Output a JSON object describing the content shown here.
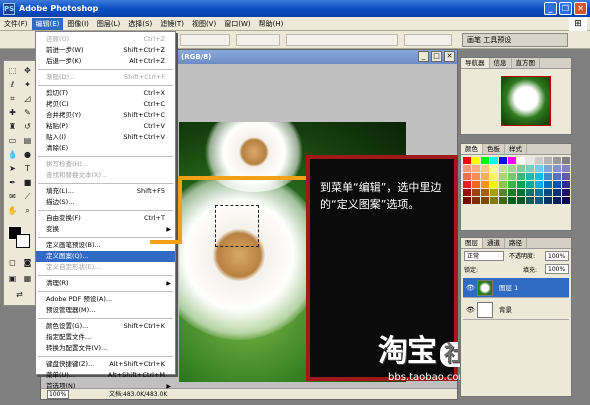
{
  "window": {
    "title": "Adobe Photoshop",
    "ps_badge": "PS"
  },
  "menubar": {
    "items": [
      "文件(F)",
      "编辑(E)",
      "图像(I)",
      "图层(L)",
      "选择(S)",
      "滤镜(T)",
      "视图(V)",
      "窗口(W)",
      "帮助(H)"
    ],
    "active_index": 1
  },
  "options": {
    "palette_tab": "画笔 工具预设"
  },
  "document": {
    "title": "(RGB/8)",
    "zoom": "100%",
    "doc_info": "文档:483.0K/483.0K"
  },
  "edit_menu": {
    "items": [
      {
        "label": "还原(O)",
        "shortcut": "Ctrl+Z",
        "disabled": true
      },
      {
        "label": "前进一步(W)",
        "shortcut": "Shift+Ctrl+Z"
      },
      {
        "label": "后退一步(K)",
        "shortcut": "Alt+Ctrl+Z"
      },
      {
        "sep": true
      },
      {
        "label": "渐隐(D)...",
        "shortcut": "Shift+Ctrl+F",
        "disabled": true
      },
      {
        "sep": true
      },
      {
        "label": "剪切(T)",
        "shortcut": "Ctrl+X"
      },
      {
        "label": "拷贝(C)",
        "shortcut": "Ctrl+C"
      },
      {
        "label": "合并拷贝(Y)",
        "shortcut": "Shift+Ctrl+C"
      },
      {
        "label": "粘贴(P)",
        "shortcut": "Ctrl+V"
      },
      {
        "label": "贴入(I)",
        "shortcut": "Shift+Ctrl+V"
      },
      {
        "label": "清除(E)",
        "shortcut": ""
      },
      {
        "sep": true
      },
      {
        "label": "拼写检查(H)...",
        "shortcut": "",
        "disabled": true
      },
      {
        "label": "查找和替换文本(X)...",
        "shortcut": "",
        "disabled": true
      },
      {
        "sep": true
      },
      {
        "label": "填充(L)...",
        "shortcut": "Shift+F5"
      },
      {
        "label": "描边(S)...",
        "shortcut": ""
      },
      {
        "sep": true
      },
      {
        "label": "自由变换(F)",
        "shortcut": "Ctrl+T"
      },
      {
        "label": "变换",
        "shortcut": "",
        "submenu": true
      },
      {
        "sep": true
      },
      {
        "label": "定义画笔预设(B)...",
        "shortcut": ""
      },
      {
        "label": "定义图案(Q)...",
        "shortcut": "",
        "selected": true
      },
      {
        "label": "定义自定形状(E)...",
        "shortcut": "",
        "disabled": true
      },
      {
        "sep": true
      },
      {
        "label": "清理(R)",
        "shortcut": "",
        "submenu": true
      },
      {
        "sep": true
      },
      {
        "label": "Adobe PDF 预设(A)...",
        "shortcut": ""
      },
      {
        "label": "预设管理器(M)...",
        "shortcut": ""
      },
      {
        "sep": true
      },
      {
        "label": "颜色设置(G)...",
        "shortcut": "Shift+Ctrl+K"
      },
      {
        "label": "指定配置文件...",
        "shortcut": ""
      },
      {
        "label": "转换为配置文件(V)...",
        "shortcut": ""
      },
      {
        "sep": true
      },
      {
        "label": "键盘快捷键(Z)...",
        "shortcut": "Alt+Shift+Ctrl+K"
      },
      {
        "label": "菜单(U)...",
        "shortcut": "Alt+Shift+Ctrl+M"
      },
      {
        "label": "首选项(N)",
        "shortcut": "",
        "submenu": true
      }
    ]
  },
  "callout": {
    "text": "到菜单“编辑”，选中里边的“定义图案”选项。"
  },
  "watermark": {
    "brand": "淘宝",
    "badge": "社区",
    "url": "bbs.taobao.com"
  },
  "navigator": {
    "tabs": [
      "导航器",
      "信息",
      "直方图"
    ]
  },
  "color_panel": {
    "tabs": [
      "颜色",
      "色板",
      "样式"
    ]
  },
  "layers_panel": {
    "tabs": [
      "图层",
      "通道",
      "路径"
    ],
    "blend_mode": "正常",
    "opacity_label": "不透明度:",
    "opacity_value": "100%",
    "lock_label": "锁定:",
    "fill_label": "填充:",
    "fill_value": "100%",
    "layers": [
      {
        "name": "图层 1",
        "selected": true
      },
      {
        "name": "背景",
        "selected": false
      }
    ]
  },
  "swatch_colors": [
    "#ff0000",
    "#ffff00",
    "#00ff00",
    "#00ffff",
    "#0000ff",
    "#ff00ff",
    "#ffffff",
    "#e6e6e6",
    "#cccccc",
    "#b3b3b3",
    "#999999",
    "#808080",
    "#f7977a",
    "#f9ad81",
    "#fdc68a",
    "#fff79a",
    "#c4df9b",
    "#a2d39c",
    "#82ca9d",
    "#7bcdc8",
    "#6ecff6",
    "#7ea7d8",
    "#8493ca",
    "#8882be",
    "#f26c4f",
    "#f68e55",
    "#fbaf5c",
    "#fff467",
    "#acd372",
    "#7cc576",
    "#3bb878",
    "#1abbb4",
    "#00bff3",
    "#438cca",
    "#5574b9",
    "#605ca8",
    "#ed1c24",
    "#f26522",
    "#f7941d",
    "#fff200",
    "#8dc73f",
    "#39b54a",
    "#00a651",
    "#00a99d",
    "#00aeef",
    "#0072bc",
    "#0054a6",
    "#2e3192",
    "#9e0b0f",
    "#a0410d",
    "#a3620a",
    "#aba000",
    "#598527",
    "#1a7b30",
    "#007236",
    "#00746b",
    "#0076a3",
    "#004b80",
    "#003471",
    "#1b1464",
    "#790000",
    "#7b2e00",
    "#7d4900",
    "#827b00",
    "#406618",
    "#005e20",
    "#005826",
    "#005952",
    "#005b7f",
    "#003663",
    "#002157",
    "#0d004c"
  ]
}
